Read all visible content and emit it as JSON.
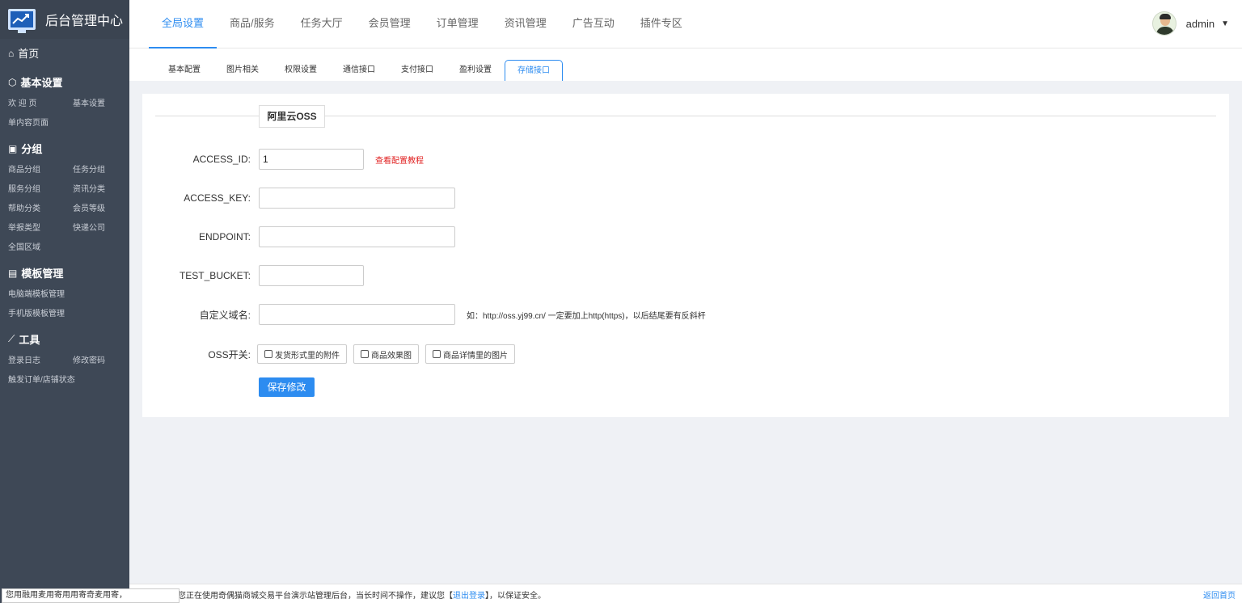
{
  "brand": {
    "title": "后台管理中心"
  },
  "sidebar": {
    "home": "首页",
    "sections": [
      {
        "title": "基本设置",
        "icon": "cube-icon",
        "items": [
          "欢 迎 页",
          "基本设置",
          "单内容页面"
        ]
      },
      {
        "title": "分组",
        "icon": "briefcase-icon",
        "items": [
          "商品分组",
          "任务分组",
          "服务分组",
          "资讯分类",
          "帮助分类",
          "会员等级",
          "举报类型",
          "快递公司",
          "全国区域"
        ]
      },
      {
        "title": "模板管理",
        "icon": "document-icon",
        "items": [
          "电脑端模板管理",
          "手机版模板管理"
        ]
      },
      {
        "title": "工具",
        "icon": "line-chart-icon",
        "items": [
          "登录日志",
          "修改密码",
          "触发订单/店铺状态"
        ]
      }
    ]
  },
  "topnav": {
    "items": [
      "全局设置",
      "商品/服务",
      "任务大厅",
      "会员管理",
      "订单管理",
      "资讯管理",
      "广告互动",
      "插件专区"
    ],
    "active": 0
  },
  "user": {
    "name": "admin"
  },
  "subtabs": {
    "items": [
      "基本配置",
      "图片相关",
      "权限设置",
      "通信接口",
      "支付接口",
      "盈利设置",
      "存储接口"
    ],
    "active": 6
  },
  "form": {
    "legend": "阿里云OSS",
    "access_id": {
      "label": "ACCESS_ID:",
      "value": "1",
      "tip": "查看配置教程"
    },
    "access_key": {
      "label": "ACCESS_KEY:",
      "value": ""
    },
    "endpoint": {
      "label": "ENDPOINT:",
      "value": ""
    },
    "test_bucket": {
      "label": "TEST_BUCKET:",
      "value": ""
    },
    "domain": {
      "label": "自定义域名:",
      "value": "",
      "tip": "如：http://oss.yj99.cn/ 一定要加上http(https)，以后结尾要有反斜杆"
    },
    "oss_switch": {
      "label": "OSS开关:",
      "options": [
        "发货形式里的附件",
        "商品效果图",
        "商品详情里的图片"
      ]
    },
    "save": "保存修改"
  },
  "footer": {
    "msg_prefix": "您正在使用奇偶猫商城交易平台演示站管理后台，当长时间不操作，建议您【",
    "logout": "退出登录",
    "msg_suffix": "】，以保证安全。",
    "home": "返回首页"
  },
  "tipbox": "您用融用麦用寄用用寄奇麦用寄，"
}
